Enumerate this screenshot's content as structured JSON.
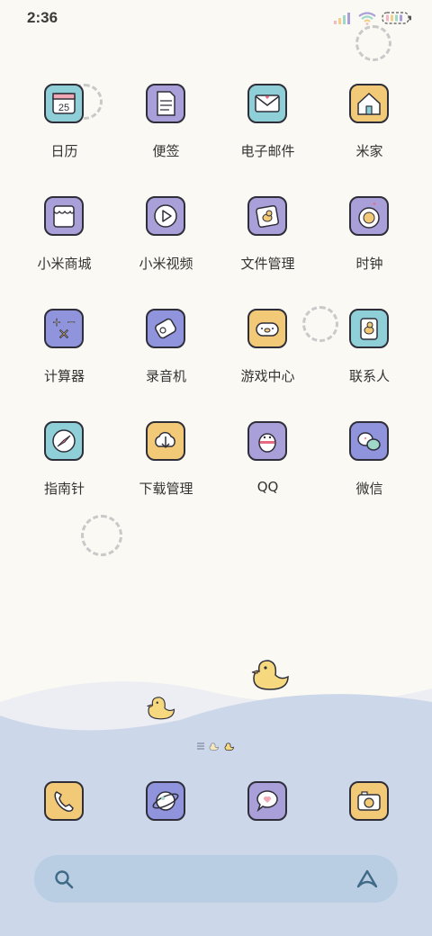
{
  "status_bar": {
    "time": "2:36"
  },
  "apps": [
    {
      "label": "日历",
      "icon": "calendar-icon",
      "color": "#8fcfd8",
      "date": "25"
    },
    {
      "label": "便签",
      "icon": "note-icon",
      "color": "#a9a0d9"
    },
    {
      "label": "电子邮件",
      "icon": "mail-icon",
      "color": "#8fcfd8"
    },
    {
      "label": "米家",
      "icon": "home-icon",
      "color": "#f1c977"
    },
    {
      "label": "小米商城",
      "icon": "store-icon",
      "color": "#a9a0d9"
    },
    {
      "label": "小米视频",
      "icon": "video-icon",
      "color": "#a9a0d9"
    },
    {
      "label": "文件管理",
      "icon": "folder-icon",
      "color": "#a9a0d9"
    },
    {
      "label": "时钟",
      "icon": "clock-icon",
      "color": "#a9a0d9"
    },
    {
      "label": "计算器",
      "icon": "calculator-icon",
      "color": "#8f94dc"
    },
    {
      "label": "录音机",
      "icon": "recorder-icon",
      "color": "#8f94dc"
    },
    {
      "label": "游戏中心",
      "icon": "gamepad-icon",
      "color": "#f1c977"
    },
    {
      "label": "联系人",
      "icon": "contacts-icon",
      "color": "#8fcfd8"
    },
    {
      "label": "指南针",
      "icon": "compass-icon",
      "color": "#8fcfd8"
    },
    {
      "label": "下载管理",
      "icon": "download-icon",
      "color": "#f1c977"
    },
    {
      "label": "QQ",
      "icon": "qq-penguin-icon",
      "color": "#a9a0d9"
    },
    {
      "label": "微信",
      "icon": "wechat-icon",
      "color": "#8f94dc"
    }
  ],
  "dock": [
    {
      "icon": "phone-icon",
      "color": "#f1c977"
    },
    {
      "icon": "browser-planet-icon",
      "color": "#8f94dc"
    },
    {
      "icon": "messages-icon",
      "color": "#a9a0d9"
    },
    {
      "icon": "camera-icon",
      "color": "#f1c977"
    }
  ]
}
